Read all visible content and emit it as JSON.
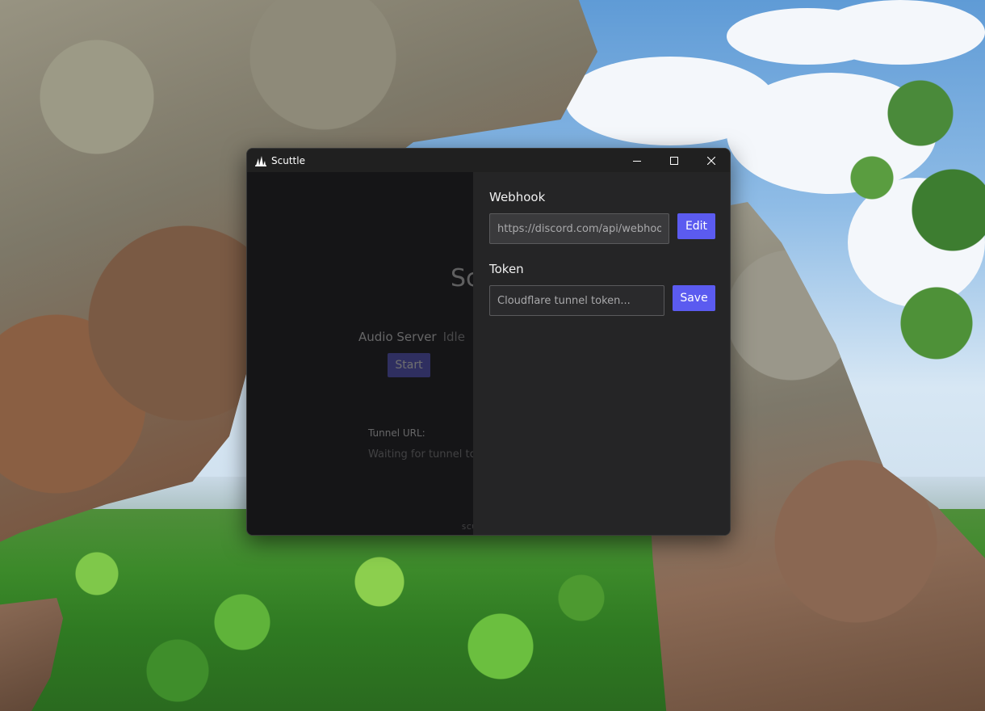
{
  "window": {
    "title": "Scuttle"
  },
  "left_panel": {
    "title": "Scuttle",
    "audio_server_label": "Audio Server",
    "audio_server_status": "Idle",
    "start_label": "Start",
    "tunnel_url_label": "Tunnel URL:",
    "tunnel_url_value": "Waiting for tunnel to start...",
    "footer": "SCUTTLE"
  },
  "settings": {
    "webhook": {
      "label": "Webhook",
      "value": "https://discord.com/api/webhooks/",
      "button_label": "Edit"
    },
    "token": {
      "label": "Token",
      "placeholder": "Cloudflare tunnel token...",
      "value": "",
      "button_label": "Save"
    }
  },
  "colors": {
    "accent": "#5b5bf0",
    "titlebar": "#202020",
    "left_pane": "#151517",
    "right_pane": "#252526"
  }
}
